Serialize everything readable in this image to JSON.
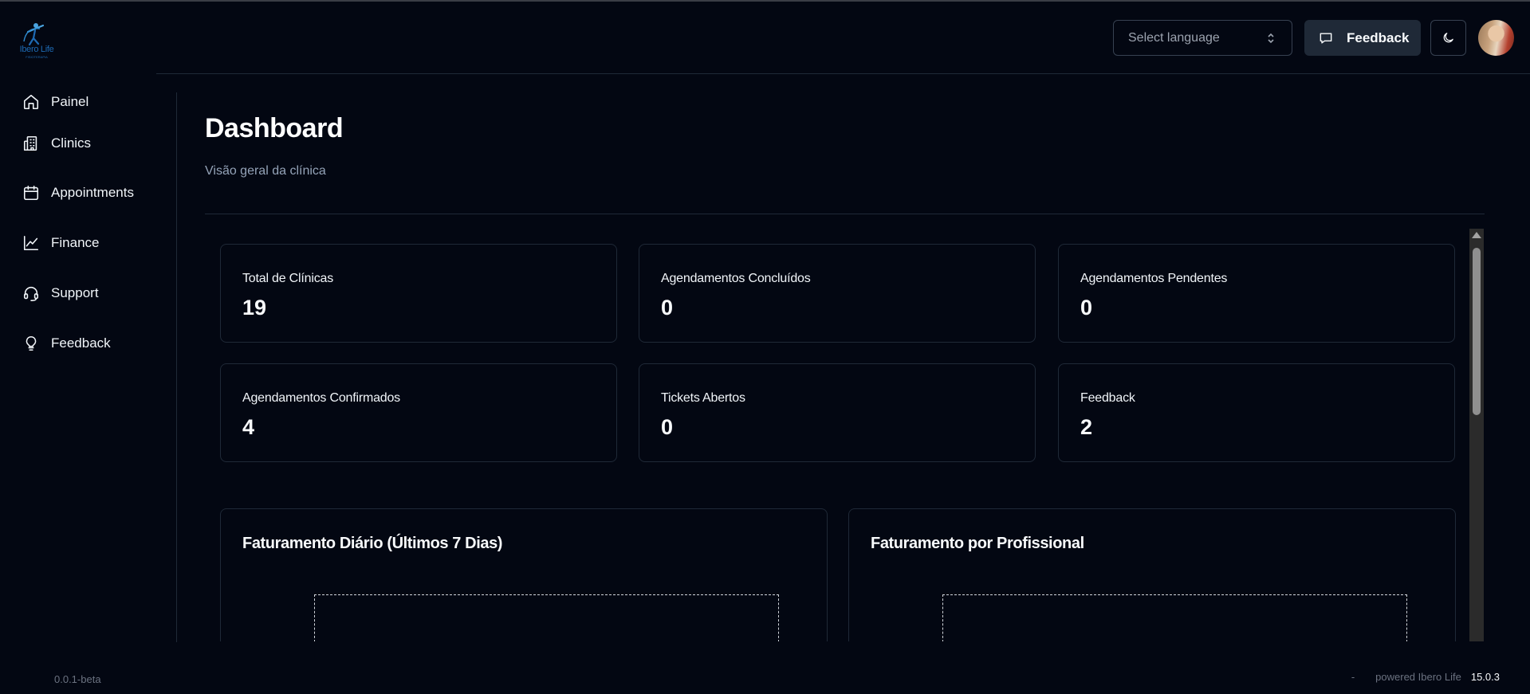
{
  "brand": {
    "logo_text": "Ibero Life",
    "logo_subtext": "FISIOTERAPIA"
  },
  "sidebar": {
    "items": [
      {
        "label": "Painel",
        "icon": "home-icon"
      },
      {
        "label": "Clinics",
        "icon": "building-icon"
      },
      {
        "label": "Appointments",
        "icon": "calendar-icon"
      },
      {
        "label": "Finance",
        "icon": "line-chart-icon"
      },
      {
        "label": "Support",
        "icon": "headset-icon"
      },
      {
        "label": "Feedback",
        "icon": "lightbulb-icon"
      }
    ],
    "version": "0.0.1-beta"
  },
  "header": {
    "language_select": {
      "placeholder": "Select language"
    },
    "feedback_button": "Feedback"
  },
  "main": {
    "title": "Dashboard",
    "subtitle": "Visão geral da clínica",
    "stats": [
      {
        "label": "Total de Clínicas",
        "value": "19"
      },
      {
        "label": "Agendamentos Concluídos",
        "value": "0"
      },
      {
        "label": "Agendamentos Pendentes",
        "value": "0"
      },
      {
        "label": "Agendamentos Confirmados",
        "value": "4"
      },
      {
        "label": "Tickets Abertos",
        "value": "0"
      },
      {
        "label": "Feedback",
        "value": "2"
      }
    ],
    "charts": [
      {
        "title": "Faturamento Diário (Últimos 7 Dias)"
      },
      {
        "title": "Faturamento por Profissional"
      }
    ]
  },
  "footer": {
    "separator": "-",
    "powered": "powered Ibero Life",
    "version": "15.0.3"
  }
}
